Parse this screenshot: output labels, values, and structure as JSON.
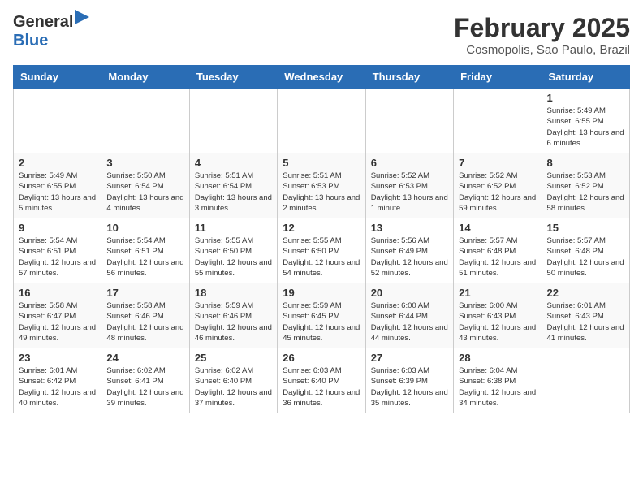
{
  "header": {
    "logo_general": "General",
    "logo_blue": "Blue",
    "month": "February 2025",
    "location": "Cosmopolis, Sao Paulo, Brazil"
  },
  "days_of_week": [
    "Sunday",
    "Monday",
    "Tuesday",
    "Wednesday",
    "Thursday",
    "Friday",
    "Saturday"
  ],
  "weeks": [
    [
      {
        "day": null
      },
      {
        "day": null
      },
      {
        "day": null
      },
      {
        "day": null
      },
      {
        "day": null
      },
      {
        "day": null
      },
      {
        "day": "1",
        "sunrise": "5:49 AM",
        "sunset": "6:55 PM",
        "daylight": "13 hours and 6 minutes."
      }
    ],
    [
      {
        "day": "2",
        "sunrise": "5:49 AM",
        "sunset": "6:55 PM",
        "daylight": "13 hours and 5 minutes."
      },
      {
        "day": "3",
        "sunrise": "5:50 AM",
        "sunset": "6:54 PM",
        "daylight": "13 hours and 4 minutes."
      },
      {
        "day": "4",
        "sunrise": "5:51 AM",
        "sunset": "6:54 PM",
        "daylight": "13 hours and 3 minutes."
      },
      {
        "day": "5",
        "sunrise": "5:51 AM",
        "sunset": "6:53 PM",
        "daylight": "13 hours and 2 minutes."
      },
      {
        "day": "6",
        "sunrise": "5:52 AM",
        "sunset": "6:53 PM",
        "daylight": "13 hours and 1 minute."
      },
      {
        "day": "7",
        "sunrise": "5:52 AM",
        "sunset": "6:52 PM",
        "daylight": "12 hours and 59 minutes."
      },
      {
        "day": "8",
        "sunrise": "5:53 AM",
        "sunset": "6:52 PM",
        "daylight": "12 hours and 58 minutes."
      }
    ],
    [
      {
        "day": "9",
        "sunrise": "5:54 AM",
        "sunset": "6:51 PM",
        "daylight": "12 hours and 57 minutes."
      },
      {
        "day": "10",
        "sunrise": "5:54 AM",
        "sunset": "6:51 PM",
        "daylight": "12 hours and 56 minutes."
      },
      {
        "day": "11",
        "sunrise": "5:55 AM",
        "sunset": "6:50 PM",
        "daylight": "12 hours and 55 minutes."
      },
      {
        "day": "12",
        "sunrise": "5:55 AM",
        "sunset": "6:50 PM",
        "daylight": "12 hours and 54 minutes."
      },
      {
        "day": "13",
        "sunrise": "5:56 AM",
        "sunset": "6:49 PM",
        "daylight": "12 hours and 52 minutes."
      },
      {
        "day": "14",
        "sunrise": "5:57 AM",
        "sunset": "6:48 PM",
        "daylight": "12 hours and 51 minutes."
      },
      {
        "day": "15",
        "sunrise": "5:57 AM",
        "sunset": "6:48 PM",
        "daylight": "12 hours and 50 minutes."
      }
    ],
    [
      {
        "day": "16",
        "sunrise": "5:58 AM",
        "sunset": "6:47 PM",
        "daylight": "12 hours and 49 minutes."
      },
      {
        "day": "17",
        "sunrise": "5:58 AM",
        "sunset": "6:46 PM",
        "daylight": "12 hours and 48 minutes."
      },
      {
        "day": "18",
        "sunrise": "5:59 AM",
        "sunset": "6:46 PM",
        "daylight": "12 hours and 46 minutes."
      },
      {
        "day": "19",
        "sunrise": "5:59 AM",
        "sunset": "6:45 PM",
        "daylight": "12 hours and 45 minutes."
      },
      {
        "day": "20",
        "sunrise": "6:00 AM",
        "sunset": "6:44 PM",
        "daylight": "12 hours and 44 minutes."
      },
      {
        "day": "21",
        "sunrise": "6:00 AM",
        "sunset": "6:43 PM",
        "daylight": "12 hours and 43 minutes."
      },
      {
        "day": "22",
        "sunrise": "6:01 AM",
        "sunset": "6:43 PM",
        "daylight": "12 hours and 41 minutes."
      }
    ],
    [
      {
        "day": "23",
        "sunrise": "6:01 AM",
        "sunset": "6:42 PM",
        "daylight": "12 hours and 40 minutes."
      },
      {
        "day": "24",
        "sunrise": "6:02 AM",
        "sunset": "6:41 PM",
        "daylight": "12 hours and 39 minutes."
      },
      {
        "day": "25",
        "sunrise": "6:02 AM",
        "sunset": "6:40 PM",
        "daylight": "12 hours and 37 minutes."
      },
      {
        "day": "26",
        "sunrise": "6:03 AM",
        "sunset": "6:40 PM",
        "daylight": "12 hours and 36 minutes."
      },
      {
        "day": "27",
        "sunrise": "6:03 AM",
        "sunset": "6:39 PM",
        "daylight": "12 hours and 35 minutes."
      },
      {
        "day": "28",
        "sunrise": "6:04 AM",
        "sunset": "6:38 PM",
        "daylight": "12 hours and 34 minutes."
      },
      {
        "day": null
      }
    ]
  ]
}
